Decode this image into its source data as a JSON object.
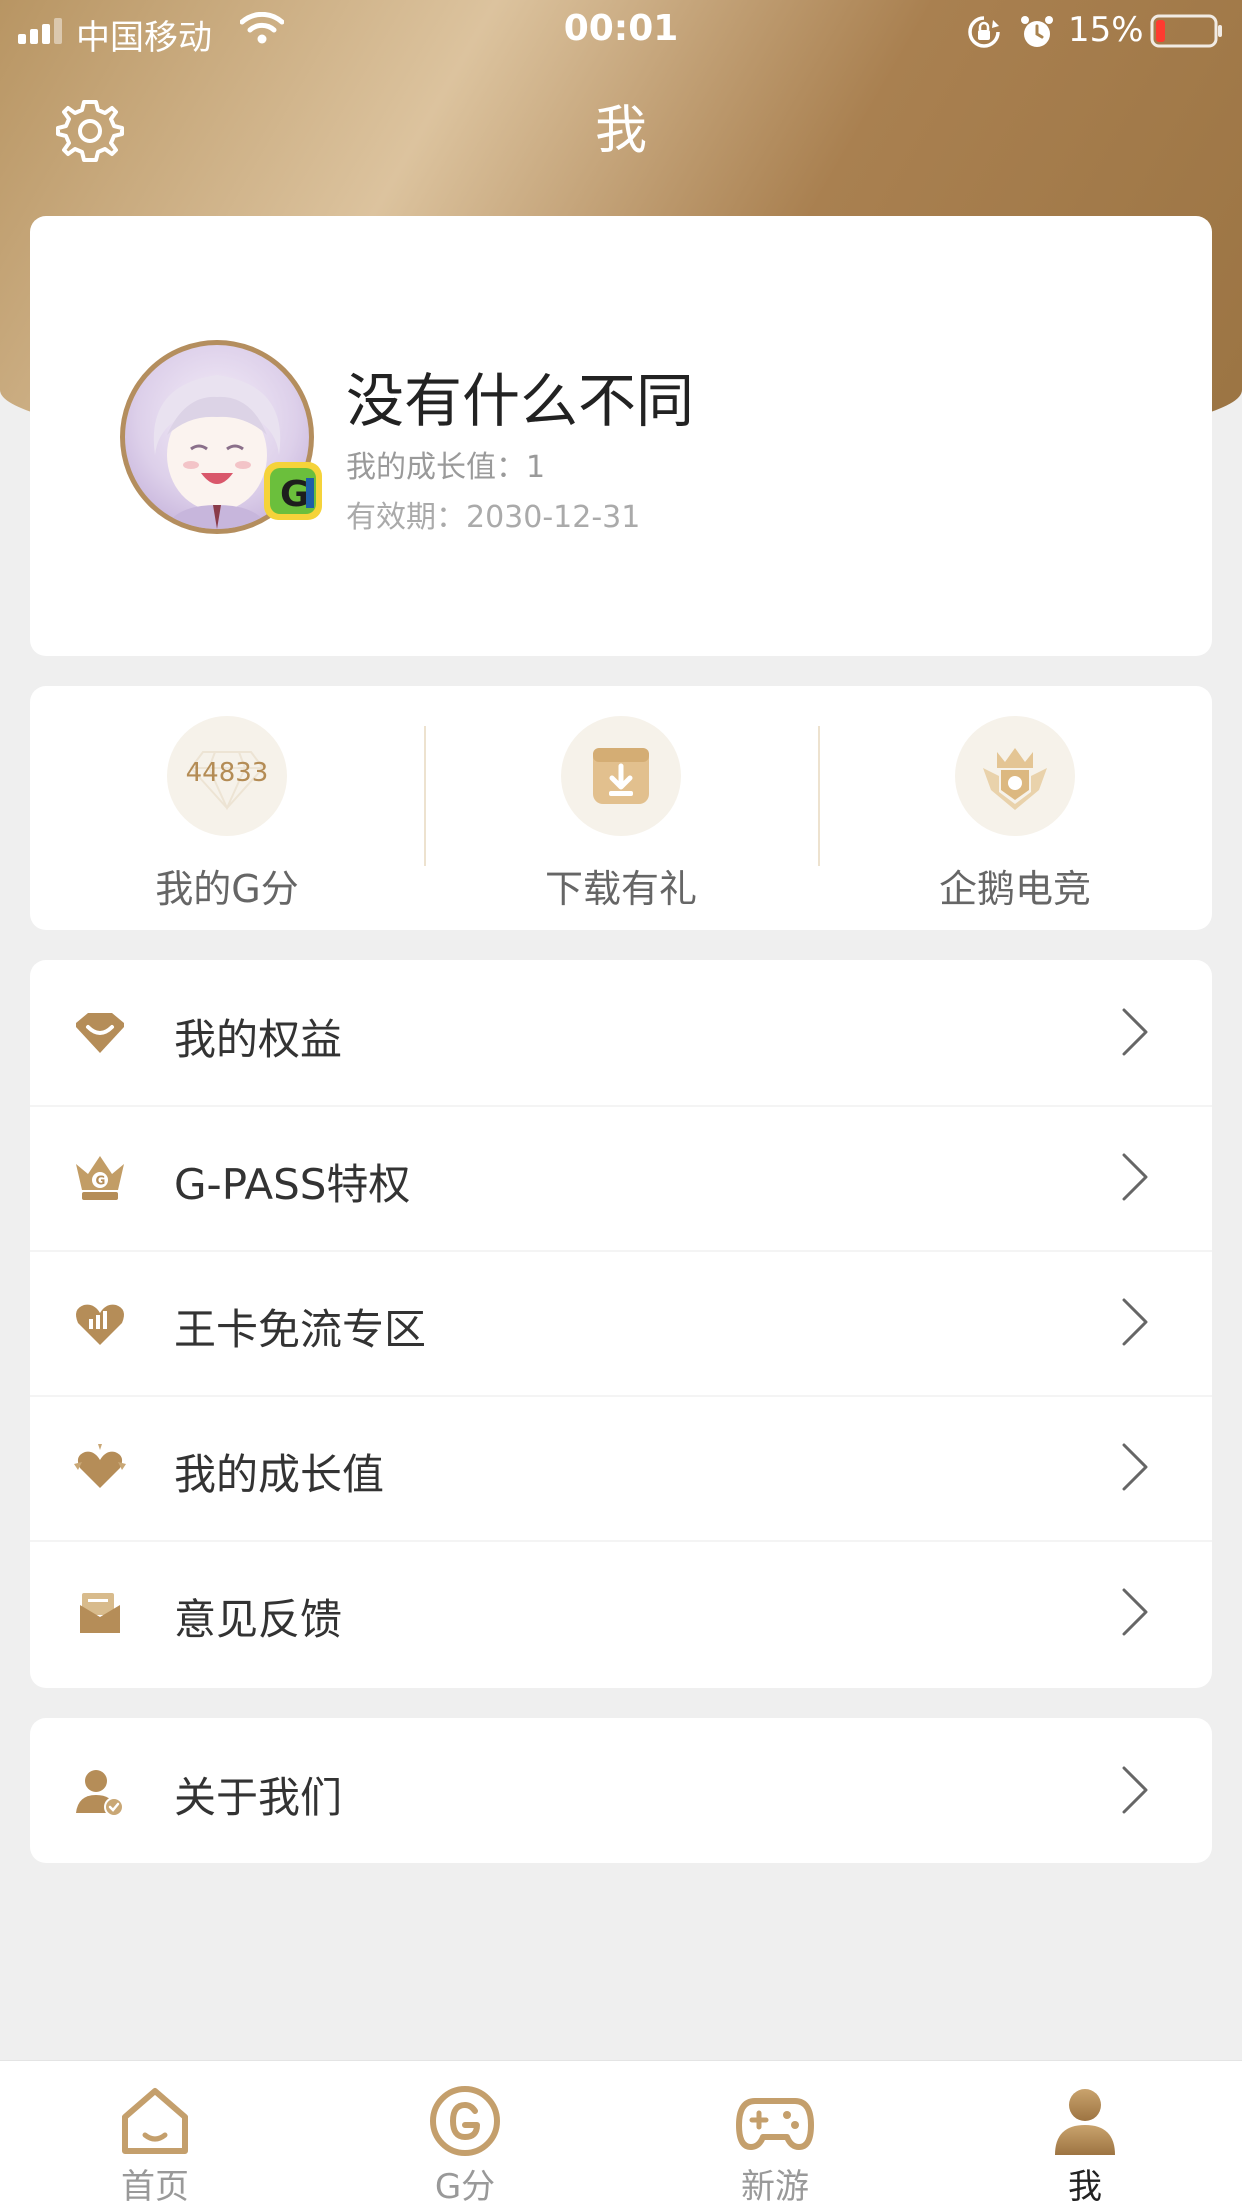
{
  "status_bar": {
    "carrier": "中国移动",
    "time": "00:01",
    "battery": "15%"
  },
  "header": {
    "title": "我"
  },
  "profile": {
    "name": "没有什么不同",
    "growth": "我的成长值：1",
    "expiry": "有效期：2030-12-31"
  },
  "quick_actions": [
    {
      "label": "我的G分",
      "value": "44833",
      "icon": "diamond-icon"
    },
    {
      "label": "下载有礼",
      "icon": "download-icon"
    },
    {
      "label": "企鹅电竞",
      "icon": "crown-shield-icon"
    }
  ],
  "menu": [
    {
      "label": "我的权益",
      "icon": "gem-icon"
    },
    {
      "label": "G-PASS特权",
      "icon": "crown-icon"
    },
    {
      "label": "王卡免流专区",
      "icon": "heart-chart-icon"
    },
    {
      "label": "我的成长值",
      "icon": "heart-growth-icon"
    },
    {
      "label": "意见反馈",
      "icon": "mail-icon"
    }
  ],
  "about": {
    "label": "关于我们",
    "icon": "user-check-icon"
  },
  "tabs": [
    {
      "label": "首页",
      "icon": "home-icon"
    },
    {
      "label": "G分",
      "icon": "g-coin-icon"
    },
    {
      "label": "新游",
      "icon": "gamepad-icon"
    },
    {
      "label": "我",
      "icon": "person-icon",
      "active": true
    }
  ],
  "colors": {
    "gold": "#b48e5e",
    "gold_dark": "#9b7443",
    "background": "#efefef"
  }
}
